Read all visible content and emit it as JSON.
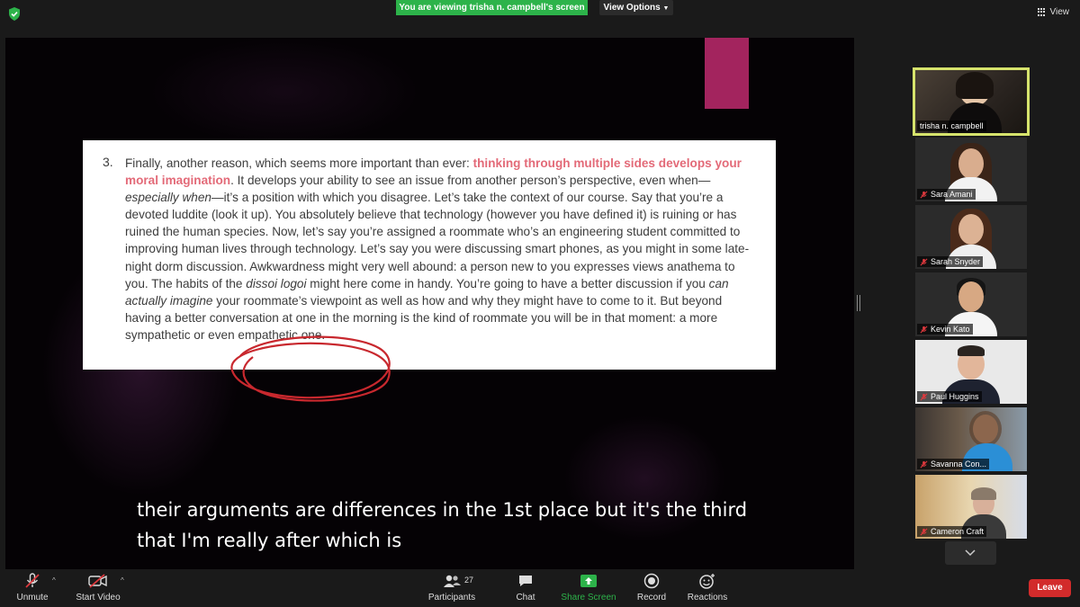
{
  "topbar": {
    "banner": "You are viewing trisha n. campbell's screen",
    "view_options": "View Options",
    "view_button": "View"
  },
  "document": {
    "number": "3.",
    "lines_before_italic": "Finally, another reason, which seems more important than ever: ",
    "highlight": "thinking through multiple sides develops your moral imagination",
    "part1": ". It develops your ability to see an issue from another person’s perspective, even when—",
    "italic1": "especially when",
    "part2": "—it’s a position with which you disagree. Let’s take the context of our course. Say that you’re a devoted luddite (look it up). You absolutely believe that technology (however you have defined it) is ruining or has ruined the human species. Now, let’s say you’re assigned a roommate who’s an engineering student committed to improving human lives through technology. Let’s say you were discussing smart phones, as you might in some late-night dorm discussion. Awkwardness might very well abound: a person new to you expresses views anathema to you. The habits of the ",
    "italic2": "dissoi logoi",
    "part3": " might here come in handy. You’re going to have a better discussion if you ",
    "italic3": "can actually imagine",
    "part4": " your roommate’s viewpoint as well as how and why they might have to come to it. But beyond having a better conversation at one in the morning is the kind of roommate you will be in that moment: a more sympathetic or even empathetic one."
  },
  "caption": {
    "line1": "their arguments are differences in the 1st place but it's the third",
    "line2": "that I'm really after which is"
  },
  "participants": [
    {
      "name": "trisha n. campbell",
      "muted": false,
      "active": true
    },
    {
      "name": "Sara Amani",
      "muted": true
    },
    {
      "name": "Sarah Snyder",
      "muted": true
    },
    {
      "name": "Kevin Kato",
      "muted": true
    },
    {
      "name": "Paul Huggins",
      "muted": true
    },
    {
      "name": "Savanna Con...",
      "muted": true
    },
    {
      "name": "Cameron Craft",
      "muted": true
    }
  ],
  "toolbar": {
    "unmute": "Unmute",
    "start_video": "Start Video",
    "participants": "Participants",
    "participants_count": "27",
    "chat": "Chat",
    "share_screen": "Share Screen",
    "record": "Record",
    "reactions": "Reactions",
    "leave": "Leave"
  },
  "colors": {
    "banner_green": "#2db34a",
    "share_green": "#2db34a",
    "highlight_pink": "#e36a78",
    "active_border": "#d6e36c",
    "leave_red": "#d22b2b",
    "annotation_red": "#c8282e"
  }
}
